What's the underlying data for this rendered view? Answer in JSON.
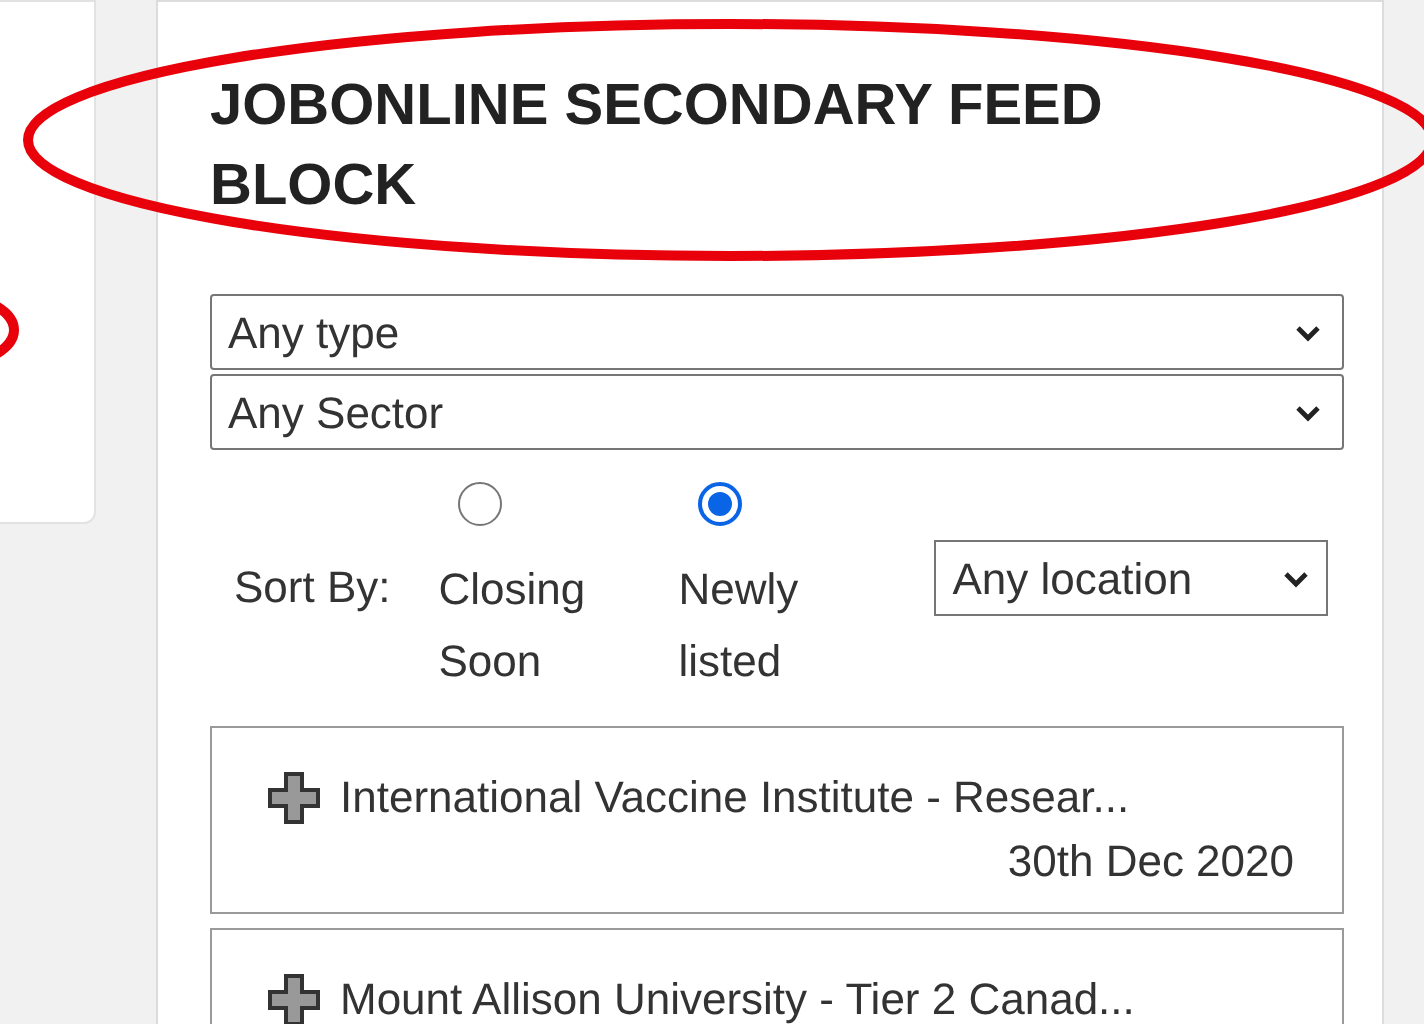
{
  "title": "JOBONLINE SECONDARY FEED BLOCK",
  "filters": [
    {
      "value": "Any type"
    },
    {
      "value": "Any Sector"
    }
  ],
  "sort": {
    "label": "Sort By:",
    "options": [
      {
        "label": "Closing Soon",
        "selected": false
      },
      {
        "label": "Newly listed",
        "selected": true
      }
    ]
  },
  "location": {
    "value": "Any location"
  },
  "jobs": [
    {
      "title": "International Vaccine Institute - Resear...",
      "date": "30th Dec 2020"
    },
    {
      "title": "Mount Allison University - Tier 2 Canad..."
    }
  ]
}
